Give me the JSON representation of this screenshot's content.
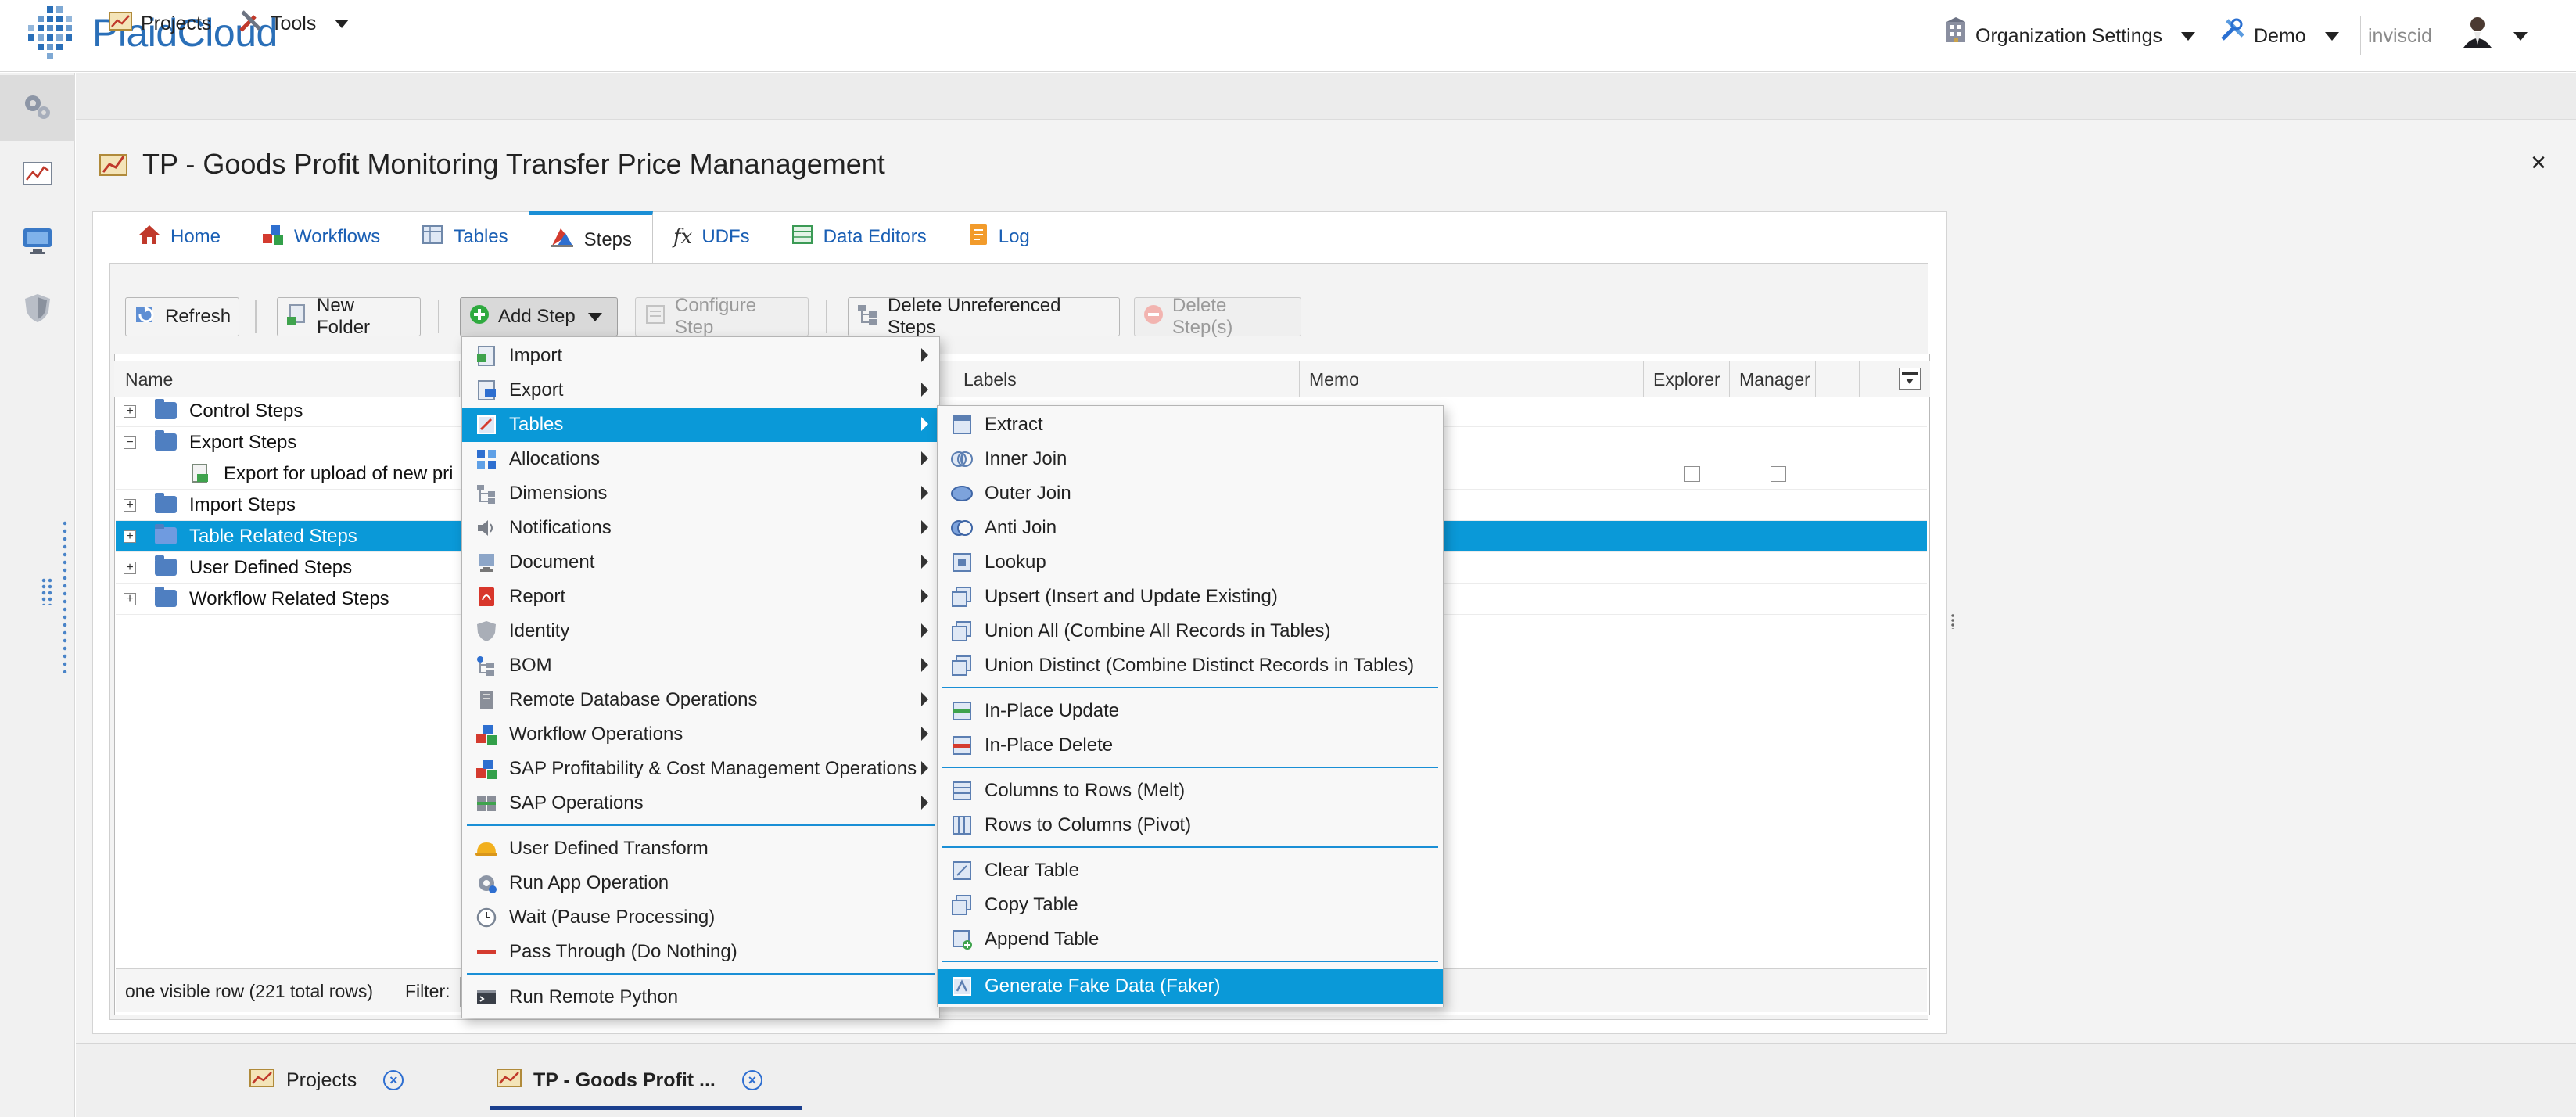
{
  "header": {
    "logo_text": "PlaidCloud",
    "org_settings": "Organization Settings",
    "workspace": "Demo",
    "username": "inviscid"
  },
  "toolbar": {
    "projects": "Projects",
    "tools": "Tools"
  },
  "page": {
    "title": "TP - Goods Profit Monitoring Transfer Price Mananagement",
    "close": "×"
  },
  "tabs": [
    {
      "label": "Home"
    },
    {
      "label": "Workflows"
    },
    {
      "label": "Tables"
    },
    {
      "label": "Steps"
    },
    {
      "label": "UDFs"
    },
    {
      "label": "Data Editors"
    },
    {
      "label": "Log"
    }
  ],
  "actions": {
    "refresh": "Refresh",
    "new_folder": "New Folder",
    "add_step": "Add Step",
    "configure_step": "Configure Step",
    "delete_unreferenced": "Delete Unreferenced Steps",
    "delete_steps": "Delete Step(s)"
  },
  "grid": {
    "columns": [
      "Name",
      "Labels",
      "Memo",
      "Explorer",
      "Manager"
    ],
    "rows": [
      {
        "label": "Control Steps"
      },
      {
        "label": "Export Steps"
      },
      {
        "label": "Export for upload of new pri"
      },
      {
        "label": "Import Steps"
      },
      {
        "label": "Table Related Steps"
      },
      {
        "label": "User Defined Steps"
      },
      {
        "label": "Workflow Related Steps"
      }
    ],
    "footer_count": "one visible row (221 total rows)",
    "footer_filter": "Filter:"
  },
  "menu_main": [
    {
      "label": "Import"
    },
    {
      "label": "Export"
    },
    {
      "label": "Tables"
    },
    {
      "label": "Allocations"
    },
    {
      "label": "Dimensions"
    },
    {
      "label": "Notifications"
    },
    {
      "label": "Document"
    },
    {
      "label": "Report"
    },
    {
      "label": "Identity"
    },
    {
      "label": "BOM"
    },
    {
      "label": "Remote Database Operations"
    },
    {
      "label": "Workflow Operations"
    },
    {
      "label": "SAP Profitability & Cost Management Operations"
    },
    {
      "label": "SAP Operations"
    },
    {
      "label": "User Defined Transform"
    },
    {
      "label": "Run App Operation"
    },
    {
      "label": "Wait (Pause Processing)"
    },
    {
      "label": "Pass Through (Do Nothing)"
    },
    {
      "label": "Run Remote Python"
    }
  ],
  "menu_tables": [
    {
      "label": "Extract"
    },
    {
      "label": "Inner Join"
    },
    {
      "label": "Outer Join"
    },
    {
      "label": "Anti Join"
    },
    {
      "label": "Lookup"
    },
    {
      "label": "Upsert (Insert and Update Existing)"
    },
    {
      "label": "Union All (Combine All Records in Tables)"
    },
    {
      "label": "Union Distinct (Combine Distinct Records in Tables)"
    },
    {
      "label": "In-Place Update"
    },
    {
      "label": "In-Place Delete"
    },
    {
      "label": "Columns to Rows (Melt)"
    },
    {
      "label": "Rows to Columns (Pivot)"
    },
    {
      "label": "Clear Table"
    },
    {
      "label": "Copy Table"
    },
    {
      "label": "Append Table"
    },
    {
      "label": "Generate Fake Data (Faker)"
    }
  ],
  "taskbar": {
    "projects": "Projects",
    "active": "TP - Goods Profit ..."
  },
  "colors": {
    "accent": "#0a99d8",
    "link": "#1a5fb4",
    "brand": "#2a6fb8"
  }
}
